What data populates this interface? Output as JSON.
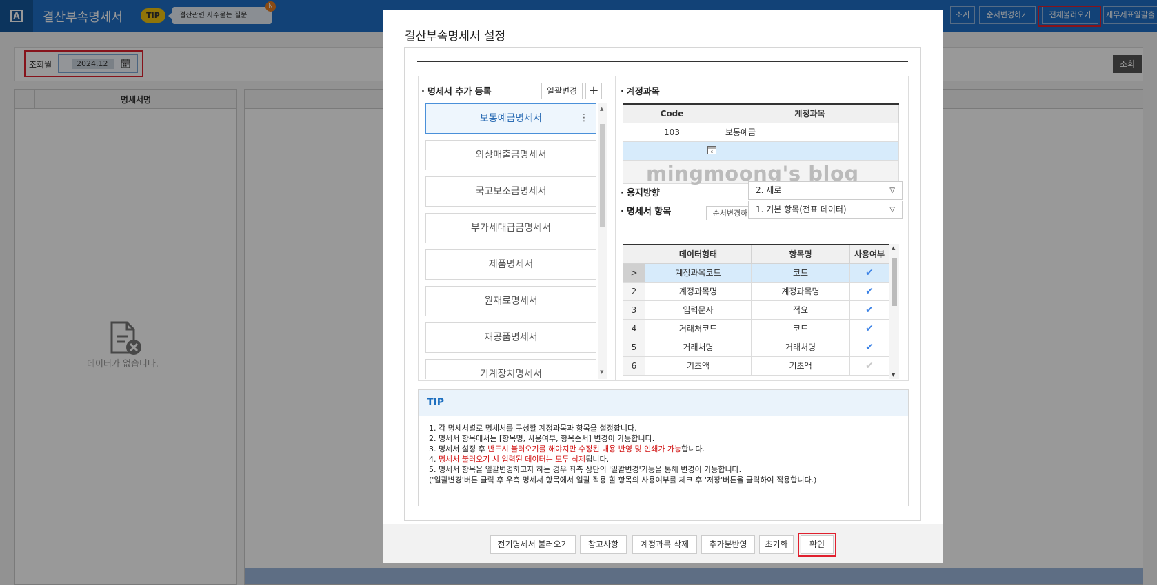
{
  "app": {
    "title": "결산부속명세서",
    "tip_label": "TIP",
    "faq_label": "결산관련 자주묻는 질문",
    "faq_badge": "N",
    "top_actions": [
      "소계",
      "순서변경하기",
      "전체불러오기",
      "재무제표일괄출"
    ]
  },
  "filter": {
    "label": "조회월",
    "month": "2024.12",
    "search_label": "조회"
  },
  "left_panel": {
    "header": "명세서명",
    "empty_text": "데이터가 없습니다."
  },
  "modal": {
    "title": "결산부속명세서 설정",
    "stmt_section_title": "명세서 추가 등록",
    "bulk_change_label": "일괄변경",
    "add_label": "+",
    "statements": [
      "보통예금명세서",
      "외상매출금명세서",
      "국고보조금명세서",
      "부가세대급금명세서",
      "제품명세서",
      "원재료명세서",
      "재공품명세서",
      "기계장치명세서"
    ],
    "account_section_title": "계정과목",
    "account_headers": [
      "Code",
      "계정과목"
    ],
    "accounts": [
      {
        "code": "103",
        "name": "보통예금"
      }
    ],
    "watermark": "mingmoong's blog",
    "orientation_label": "용지방향",
    "orientation_value": "2. 세로",
    "items_label": "명세서 항목",
    "reorder_label": "순서변경하기",
    "items_type_value": "1. 기본 항목(전표 데이터)",
    "item_headers": [
      "데이터형태",
      "항목명",
      "사용여부"
    ],
    "items": [
      {
        "idx": ">",
        "type": "계정과목코드",
        "name": "코드",
        "use": true
      },
      {
        "idx": "2",
        "type": "계정과목명",
        "name": "계정과목명",
        "use": true
      },
      {
        "idx": "3",
        "type": "입력문자",
        "name": "적요",
        "use": true
      },
      {
        "idx": "4",
        "type": "거래처코드",
        "name": "코드",
        "use": true
      },
      {
        "idx": "5",
        "type": "거래처명",
        "name": "거래처명",
        "use": true
      },
      {
        "idx": "6",
        "type": "기초액",
        "name": "기초액",
        "use": false
      }
    ],
    "tip_title": "TIP",
    "tip": {
      "l1": "1. 각 명세서별로 명세서를 구성할 계정과목과 항목을 설정합니다.",
      "l2": "2. 명세서 항목에서는 [항목명, 사용여부, 항목순서] 변경이 가능합니다.",
      "l3a": "3. 명세서 설정 후 ",
      "l3b": "반드시 불러오기를 해야지만 수정된 내용 반영 및 인쇄가 가능",
      "l3c": "합니다.",
      "l4a": "4. ",
      "l4b": "명세서 불러오기 시 입력된 데이터는 모두 삭제",
      "l4c": "됩니다.",
      "l5": "5. 명세서 항목을 일괄변경하고자 하는 경우 좌측 상단의 '일괄변경'기능을 통해 변경이 가능합니다.",
      "l6": "('일괄변경'버튼 클릭 후 우측 명세서 항목에서 일괄 적용 할 항목의 사용여부를 체크 후 '저장'버튼을 클릭하여 적용합니다.)"
    },
    "footer_buttons": [
      "전기명세서 불러오기",
      "참고사항",
      "계정과목 삭제",
      "추가분반영",
      "초기화",
      "확인"
    ]
  },
  "colors": {
    "accent": "#1f6fc6",
    "highlight": "#e0202e",
    "selected_row": "#d7ebfb"
  }
}
